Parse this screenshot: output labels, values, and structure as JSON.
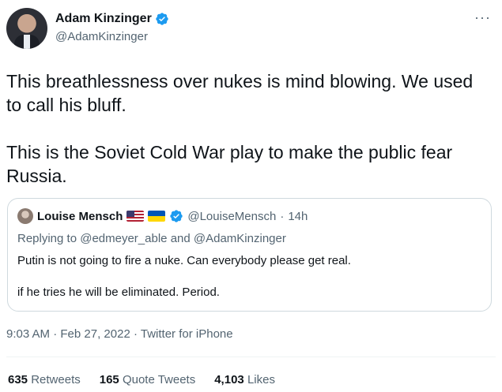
{
  "author": {
    "name": "Adam Kinzinger",
    "handle": "@AdamKinzinger"
  },
  "tweet": {
    "text": "This breathlessness over nukes is mind blowing.  We used to call his bluff.\n\nThis is the Soviet Cold War play to make the public fear Russia."
  },
  "quoted": {
    "name": "Louise Mensch",
    "handle": "@LouiseMensch",
    "sep": "·",
    "time": "14h",
    "reply_prefix": "Replying to",
    "reply_user1": "@edmeyer_able",
    "reply_and": "and",
    "reply_user2": "@AdamKinzinger",
    "text": "Putin is not going to fire a nuke. Can everybody please get real.\n\nif he tries he will be eliminated. Period."
  },
  "meta": {
    "time": "9:03 AM",
    "date": "Feb 27, 2022",
    "source": "Twitter for iPhone",
    "sep": "·"
  },
  "stats": {
    "retweets_count": "635",
    "retweets_label": "Retweets",
    "quotes_count": "165",
    "quotes_label": "Quote Tweets",
    "likes_count": "4,103",
    "likes_label": "Likes"
  },
  "colors": {
    "verified": "#1d9bf0",
    "text": "#0f1419",
    "muted": "#536471",
    "border": "#cfd9de"
  },
  "icons": [
    "verified-badge-icon",
    "more-options-icon",
    "us-flag-icon",
    "ukraine-flag-icon"
  ]
}
